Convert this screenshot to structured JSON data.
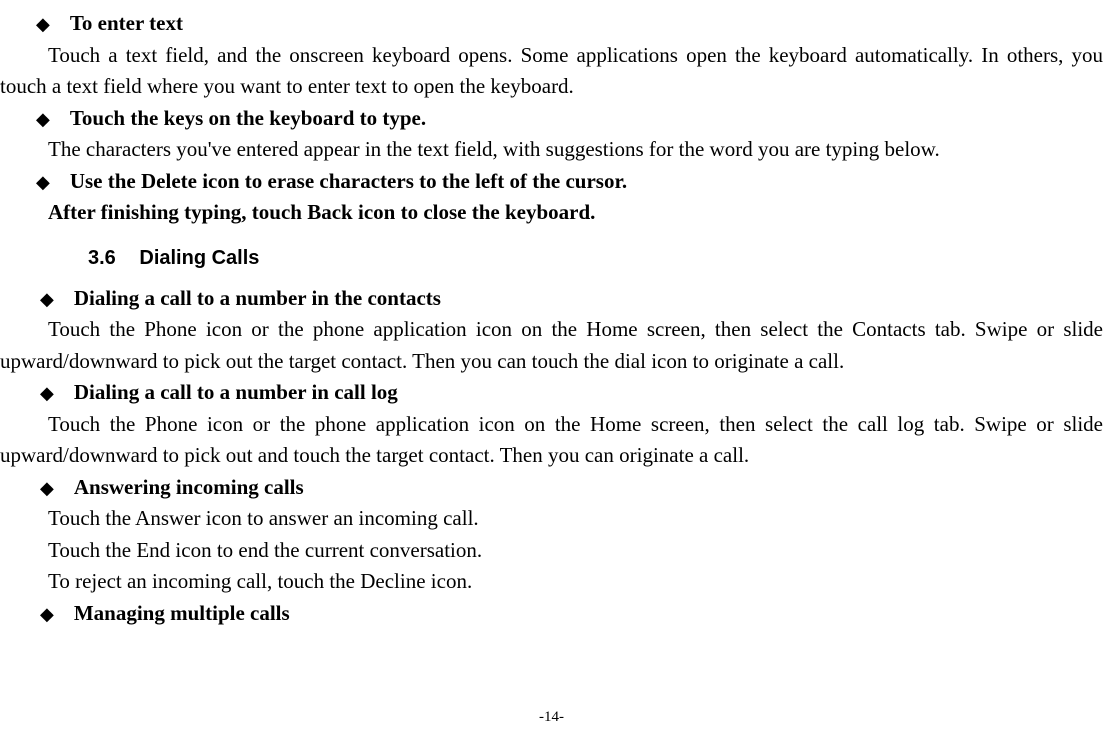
{
  "bullets": {
    "enterText": {
      "title": "To enter text",
      "body": "Touch a text field, and the onscreen keyboard opens. Some applications open the keyboard automatically. In others, you touch a text field where you want to enter text to open the keyboard."
    },
    "touchKeys": {
      "title": "Touch the keys on the keyboard to type.",
      "body": "The characters you've entered appear in the text field, with suggestions for the word you are typing below."
    },
    "deleteIcon": {
      "title": "Use the Delete icon to erase characters to the left of the cursor.",
      "subtitle": "After finishing typing, touch Back icon to close the keyboard."
    },
    "dialContacts": {
      "title": "Dialing a call to a number in the contacts",
      "body": "Touch the Phone icon or the phone application icon on the Home screen, then select the Contacts tab. Swipe or slide upward/downward to pick out the target contact. Then you can touch the dial icon to originate a call."
    },
    "dialCallLog": {
      "title": "Dialing a call to a number in call log",
      "body": "Touch the Phone icon or the phone application icon on the Home screen, then select the call log tab. Swipe or slide upward/downward to pick out and touch the target contact. Then you can originate a call."
    },
    "answering": {
      "title": "Answering incoming calls",
      "line1": "Touch the Answer icon to answer an incoming call.",
      "line2": "Touch the End icon to end the current conversation.",
      "line3": "To reject an incoming call, touch the Decline icon."
    },
    "managing": {
      "title": "Managing multiple calls"
    }
  },
  "section": {
    "number": "3.6",
    "title": "Dialing Calls"
  },
  "pageNumber": "-14-"
}
